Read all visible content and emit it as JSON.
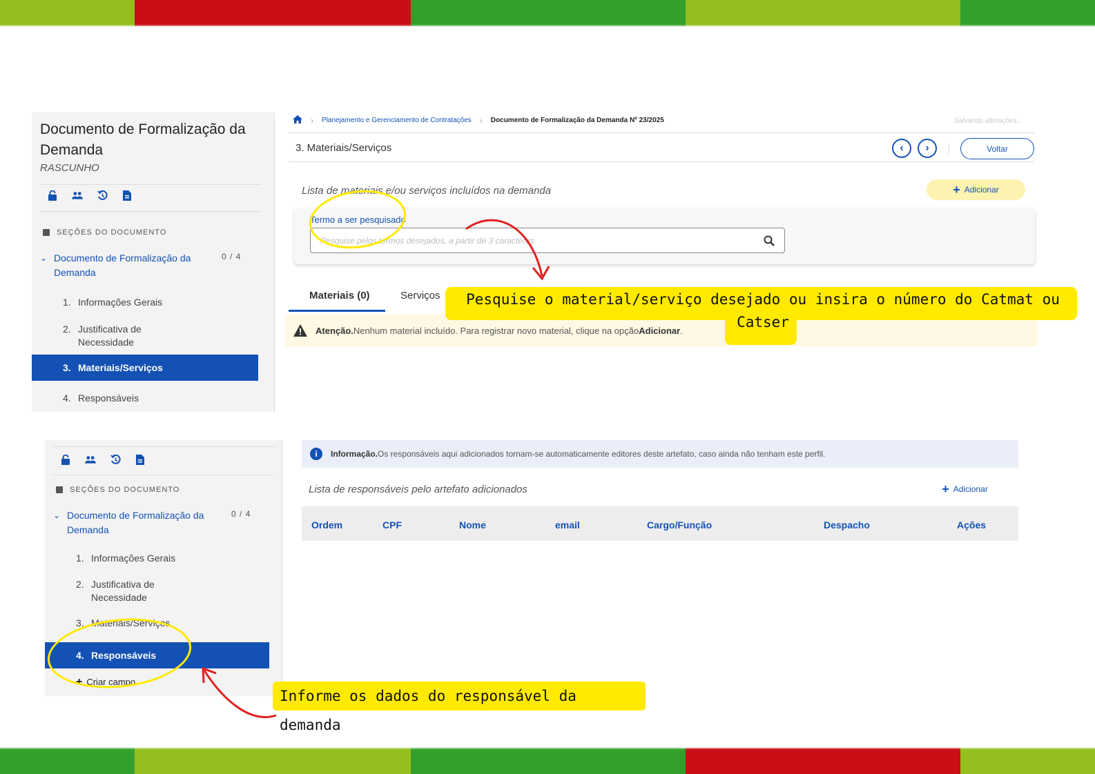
{
  "colors": {
    "brand_blue": "#1351b4",
    "stripe_light_green": "#93c01f",
    "stripe_red": "#c90f15",
    "stripe_dark_green": "#33a02c",
    "highlight_yellow": "#ffea00",
    "annotation_red": "#e02020"
  },
  "top_screen": {
    "sidebar": {
      "title": "Documento de Formalização da Demanda",
      "status": "RASCUNHO",
      "tool_icons": [
        "lock-icon",
        "users-icon",
        "history-icon",
        "document-icon"
      ],
      "section_header": "SEÇÕES DO DOCUMENTO",
      "parent_item": "Documento de Formalização da Demanda",
      "parent_count": "0 / 4",
      "items": [
        {
          "num": "1.",
          "label": "Informações Gerais"
        },
        {
          "num": "2.",
          "label": "Justificativa de Necessidade"
        },
        {
          "num": "3.",
          "label": "Materiais/Serviços"
        },
        {
          "num": "4.",
          "label": "Responsáveis"
        }
      ]
    },
    "breadcrumb": {
      "home_icon": "home-icon",
      "level1": "Planejamento e Gerenciamento de Contratações",
      "current": "Documento de Formalização da Demanda Nº 23/2025"
    },
    "saving_text": "Salvando alterações...",
    "page_title": "3. Materiais/Serviços",
    "back_button": "Voltar",
    "list_label": "Lista de materiais e/ou serviços incluídos na demanda",
    "add_button": "Adicionar",
    "search": {
      "label": "Termo a ser pesquisado",
      "placeholder": "Pesquise pelos termos desejados, a partir de 3 caracteres"
    },
    "tabs": [
      "Materiais (0)",
      "Serviços"
    ],
    "warning": {
      "strong": "Atenção.",
      "text": " Nenhum material incluído. Para registrar novo material, clique na opção ",
      "action": "Adicionar",
      "end": "."
    }
  },
  "bottom_screen": {
    "sidebar": {
      "tool_icons": [
        "lock-icon",
        "users-icon",
        "history-icon",
        "document-icon"
      ],
      "section_header": "SEÇÕES DO DOCUMENTO",
      "parent_item": "Documento de Formalização da Demanda",
      "parent_count": "0 / 4",
      "items": [
        {
          "num": "1.",
          "label": "Informações Gerais"
        },
        {
          "num": "2.",
          "label": "Justificativa de Necessidade"
        },
        {
          "num": "3.",
          "label": "Materiais/Serviços"
        },
        {
          "num": "4.",
          "label": "Responsáveis"
        }
      ],
      "create_field": "Criar campo"
    },
    "info": {
      "strong": "Informação.",
      "text": " Os responsáveis aqui adicionados tornam-se automaticamente editores deste artefato, caso ainda não tenham este perfil."
    },
    "list_label": "Lista de responsáveis pelo artefato adicionados",
    "add_button": "Adicionar",
    "table_columns": [
      "Ordem",
      "CPF",
      "Nome",
      "email",
      "Cargo/Função",
      "Despacho",
      "Ações"
    ]
  },
  "callouts": {
    "search_hint": "Pesquise o material/serviço desejado ou insira o número do Catmat ou Catser",
    "responsible_hint": "Informe os dados do responsável da demanda"
  }
}
